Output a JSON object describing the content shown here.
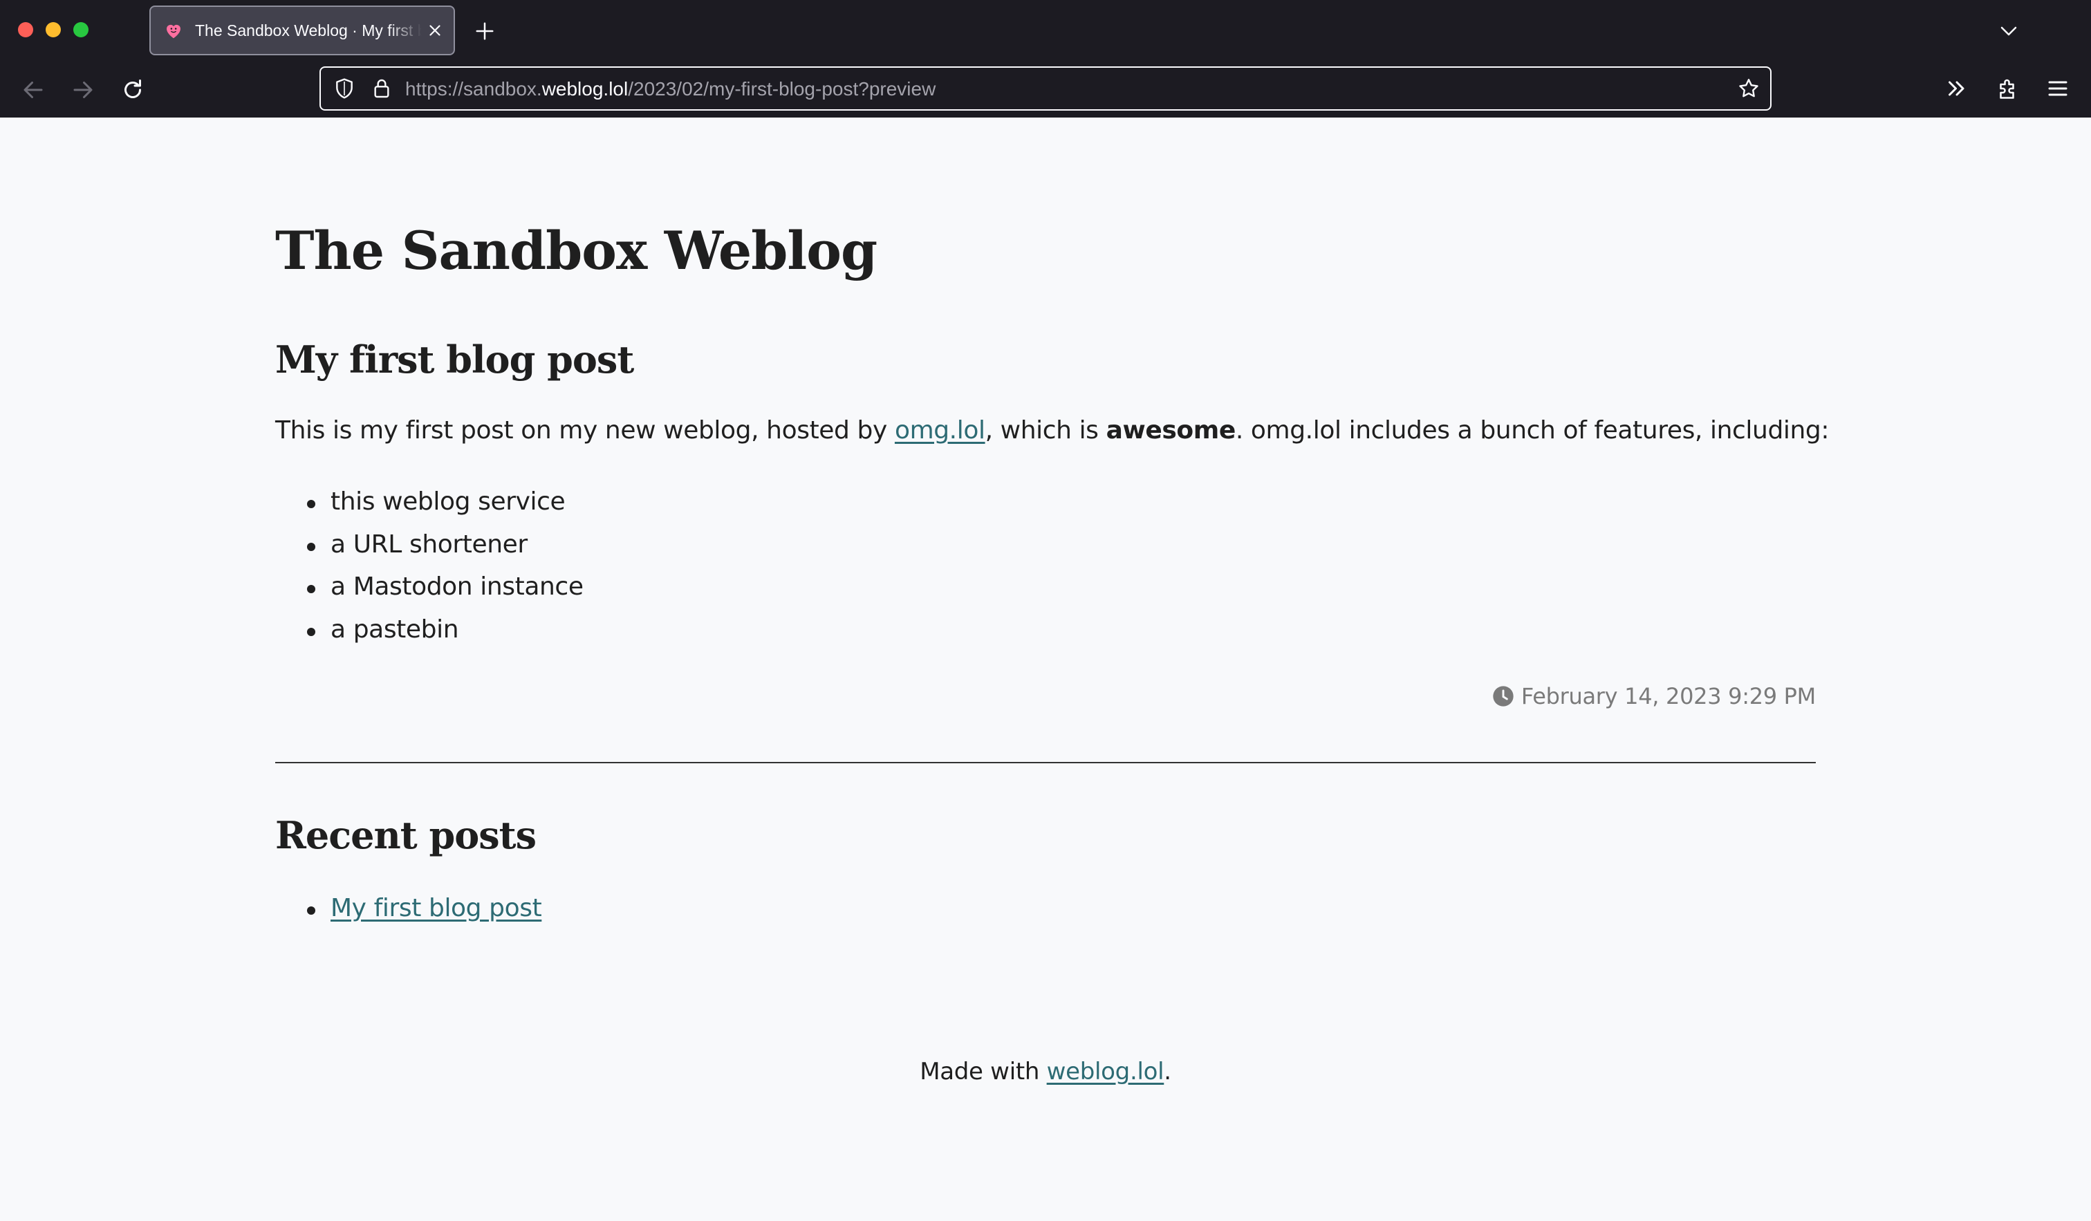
{
  "browser": {
    "tab": {
      "title": "The Sandbox Weblog · My first blog post"
    },
    "address_bar": {
      "url_scheme": "https://",
      "url_subdomain": "sandbox.",
      "url_host": "weblog.lol",
      "url_path": "/2023/02/my-first-blog-post?preview"
    },
    "colors": {
      "chrome_bg": "#1c1b22",
      "tab_bg": "#42414d",
      "accent_favicon": "#ff6fa0"
    }
  },
  "page": {
    "site_title": "The Sandbox Weblog",
    "post": {
      "title": "My first blog post",
      "intro_before_link": "This is my first post on my new weblog, hosted by ",
      "intro_link": "omg.lol",
      "intro_middle": ", which is ",
      "intro_bold": "awesome",
      "intro_after": ". omg.lol includes a bunch of features, including:",
      "features": [
        "this weblog service",
        "a URL shortener",
        "a Mastodon instance",
        "a pastebin"
      ],
      "date": "February 14, 2023 9:29 PM"
    },
    "recent": {
      "title": "Recent posts",
      "items": [
        "My first blog post"
      ]
    },
    "footer": {
      "prefix": "Made with ",
      "link": "weblog.lol",
      "suffix": "."
    },
    "colors": {
      "background": "#f8f9fb",
      "link": "#2d6b74",
      "text": "#1f1f1f",
      "muted": "#7a7a7a"
    }
  }
}
